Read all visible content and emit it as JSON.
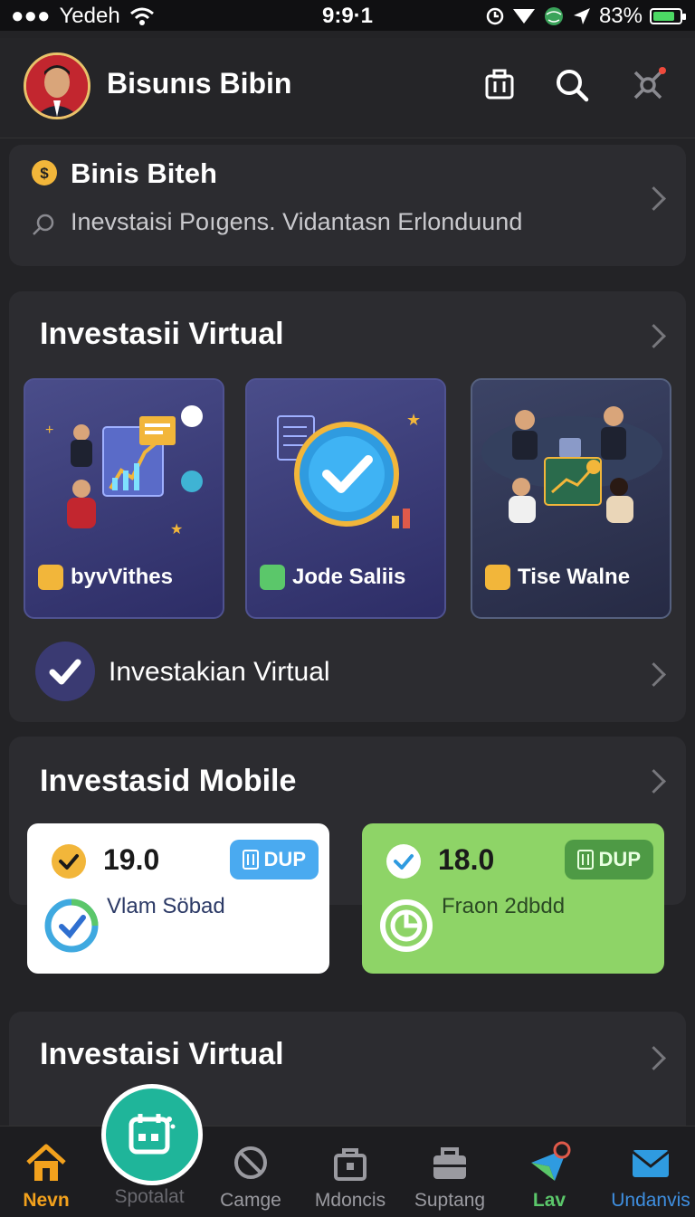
{
  "status_bar": {
    "carrier": "Yedeh",
    "time": "9:9·1",
    "battery": "83%",
    "battery_level": 0.83
  },
  "header": {
    "title": "Bisunıs Bibin"
  },
  "banner": {
    "title": "Binis Biteh",
    "subtitle": "Inevstaisi Poıgens. Vidantasn Erlonduund"
  },
  "section1": {
    "title": "Investasii Virtual",
    "tiles": [
      {
        "label": "byvVithes",
        "badge_color": "#f2b63a"
      },
      {
        "label": "Jode Saliis",
        "badge_color": "#5bc76a"
      },
      {
        "label": "Tise Walne",
        "badge_color": "#f2b63a"
      }
    ],
    "row_label": "Investakian Virtual"
  },
  "section2": {
    "title": "Investasid Mobile",
    "cards": [
      {
        "value": "19.0",
        "tag": "DUP",
        "sub": "Vlam Söbad"
      },
      {
        "value": "18.0",
        "tag": "DUP",
        "sub": "Fraon 2dbdd"
      }
    ]
  },
  "section3": {
    "title": "Investaisi Virtual"
  },
  "nav": {
    "items": [
      {
        "label": "Nevn"
      },
      {
        "label": "Spotalat"
      },
      {
        "label": "Camge"
      },
      {
        "label": "Mdoncis"
      },
      {
        "label": "Suptang"
      },
      {
        "label": "Lav"
      },
      {
        "label": "Undanvis"
      }
    ]
  },
  "colors": {
    "accent_green": "#1fb59a",
    "home_active": "#f2a11d",
    "lime_card": "#8ed467",
    "blue_tag": "#4aaaf0"
  }
}
